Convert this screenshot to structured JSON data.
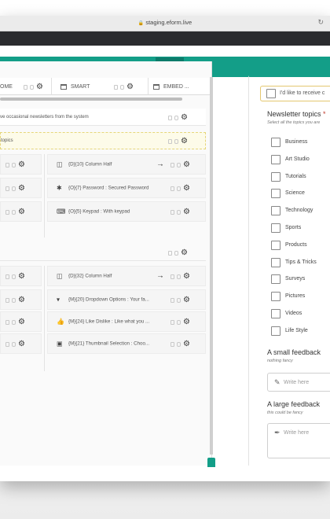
{
  "browser": {
    "url": "staging.eform.live",
    "reload_icon": "reload-icon",
    "lock_icon": "lock-icon"
  },
  "toolbar": {
    "icons": [
      "list-view-icon",
      "split-view-icon",
      "single-view-icon"
    ],
    "accent": "#139e88"
  },
  "tabs": [
    {
      "label": "OME"
    },
    {
      "label": "SMART"
    },
    {
      "label": "EMBED ..."
    }
  ],
  "rows": {
    "newsletter_text": "ve occasional newsletters from the system",
    "topics_text": "topics"
  },
  "fields": [
    {
      "code": "{D}{10} Column Half",
      "icon": "column-icon"
    },
    {
      "code": "{O}{7} Password : Secured Password",
      "icon": "asterisk-icon"
    },
    {
      "code": "{O}{5} Keypad : With keypad",
      "icon": "keyboard-icon"
    },
    {
      "code": "{D}{32} Column Half",
      "icon": "column-icon"
    },
    {
      "code": "{M}{20} Dropdown Options : Your fa...",
      "icon": "dropdown-icon"
    },
    {
      "code": "{M}{24} Like Dislike : Like what you ...",
      "icon": "thumbs-up-icon"
    },
    {
      "code": "{M}{21} Thumbnail Selection : Choo...",
      "icon": "image-icon"
    }
  ],
  "preview": {
    "consent_label": "I'd like to receive c",
    "newsletter": {
      "title": "Newsletter topics",
      "required_mark": "*",
      "subtitle": "Select all the topics you are",
      "options": [
        "Business",
        "Art Studio",
        "Tutorials",
        "Science",
        "Technology",
        "Sports",
        "Products",
        "Tips & Tricks",
        "Surveys",
        "Pictures",
        "Videos",
        "Life Style"
      ]
    },
    "small_feedback": {
      "title": "A small feedback",
      "subtitle": "nothing fancy",
      "placeholder": "Write here"
    },
    "large_feedback": {
      "title": "A large feedback",
      "subtitle": "this could be fancy",
      "placeholder": "Write here"
    }
  }
}
